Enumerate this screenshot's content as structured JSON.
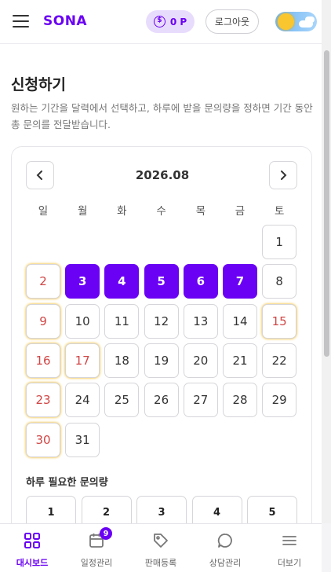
{
  "header": {
    "brand": "SONA",
    "points": "0 P",
    "logout_label": "로그아웃"
  },
  "page": {
    "title": "신청하기",
    "description": "원하는 기간을 달력에서 선택하고, 하루에 받을 문의량을 정하면 기간 동안 총 문의를 전달받습니다."
  },
  "calendar": {
    "month_label": "2026.08",
    "weekdays": [
      "일",
      "월",
      "화",
      "수",
      "목",
      "금",
      "토"
    ],
    "first_weekday_index": 6,
    "days_in_month": 31,
    "selected_days": [
      3,
      4,
      5,
      6,
      7
    ],
    "highlight_red_days": [
      2,
      9,
      15,
      16,
      17,
      23,
      30
    ]
  },
  "quantity": {
    "label": "하루 필요한 문의량",
    "options": [
      "1",
      "2",
      "3",
      "4",
      "5"
    ]
  },
  "bottom_nav": {
    "items": [
      {
        "label": "대시보드",
        "icon": "dashboard-icon",
        "active": true
      },
      {
        "label": "일정관리",
        "icon": "calendar-icon",
        "badge": "9"
      },
      {
        "label": "판매등록",
        "icon": "tag-icon"
      },
      {
        "label": "상담관리",
        "icon": "chat-icon"
      },
      {
        "label": "더보기",
        "icon": "more-menu-icon"
      }
    ]
  },
  "colors": {
    "accent": "#6a00f4",
    "sunday_red": "#d14545"
  }
}
